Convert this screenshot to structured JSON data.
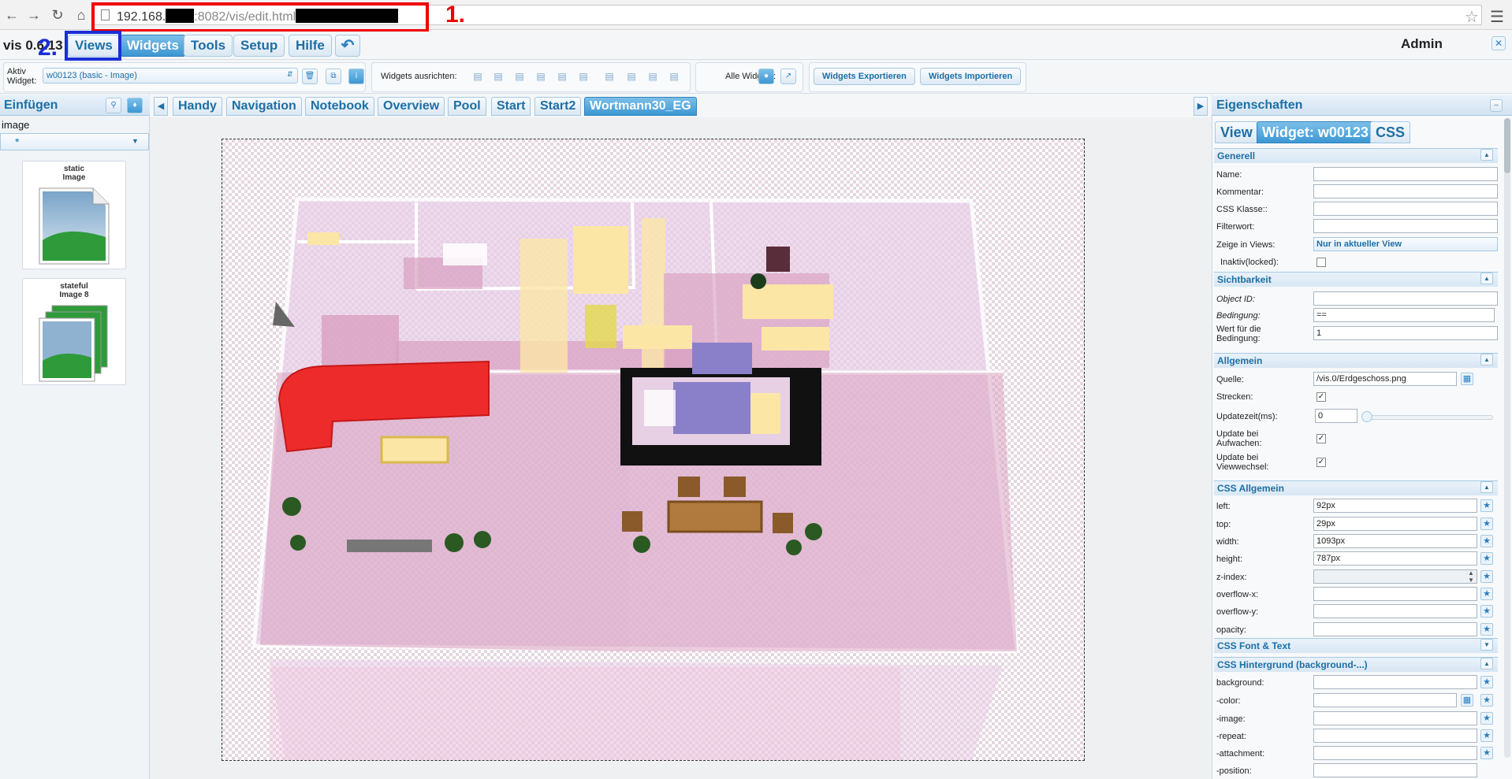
{
  "browser": {
    "url_prefix": "192.168.",
    "url_suffix": ":8082/vis/edit.html",
    "annotation1": "1."
  },
  "app": {
    "version": "vis 0.6.13",
    "annotation2": "2.",
    "menu": [
      "Views",
      "Widgets",
      "Tools",
      "Setup",
      "Hilfe"
    ],
    "active_menu": "Widgets",
    "user": "Admin"
  },
  "toolbar": {
    "aktiv_label_1": "Aktiv",
    "aktiv_label_2": "Widget:",
    "aktiv_widget": "w00123 (basic - Image)",
    "align_label": "Widgets ausrichten:",
    "alle_label": "Alle Widgets:",
    "export_label": "Widgets Exportieren",
    "import_label": "Widgets Importieren"
  },
  "left": {
    "title": "Einfügen",
    "filter_text": "image",
    "filter_select": "*",
    "widgets": [
      {
        "line1": "static",
        "line2": "Image"
      },
      {
        "line1": "stateful",
        "line2": "Image 8"
      }
    ]
  },
  "views": {
    "tabs": [
      "Handy",
      "Navigation",
      "Notebook",
      "Overview",
      "Pool",
      "Start",
      "Start2",
      "Wortmann30_EG"
    ],
    "active": "Wortmann30_EG"
  },
  "right": {
    "title": "Eigenschaften",
    "tabs": [
      "View",
      "Widget: w00123",
      "CSS"
    ],
    "active_tab": "Widget: w00123",
    "sections": {
      "generell": "Generell",
      "sichtbarkeit": "Sichtbarkeit",
      "allgemein": "Allgemein",
      "css_allgemein": "CSS Allgemein",
      "css_font": "CSS Font & Text",
      "css_bg": "CSS Hintergrund (background-...)"
    },
    "fields": {
      "name": "Name:",
      "kommentar": "Kommentar:",
      "css_klasse": "CSS Klasse::",
      "filterwort": "Filterwort:",
      "zeige_in_views": "Zeige in Views:",
      "zeige_value": "Nur in aktueller View",
      "inaktiv": "Inaktiv(locked):",
      "object_id": "Object ID:",
      "bedingung": "Bedingung:",
      "bedingung_value": "==",
      "wert_1": "Wert für die",
      "wert_2": "Bedingung:",
      "wert_value": "1",
      "quelle": "Quelle:",
      "quelle_value": "/vis.0/Erdgeschoss.png",
      "strecken": "Strecken:",
      "updatezeit": "Updatezeit(ms):",
      "updatezeit_value": "0",
      "update_aufwachen_1": "Update bei",
      "update_aufwachen_2": "Aufwachen:",
      "update_viewwechsel_1": "Update bei",
      "update_viewwechsel_2": "Viewwechsel:",
      "left": "left:",
      "left_value": "92px",
      "top": "top:",
      "top_value": "29px",
      "width": "width:",
      "width_value": "1093px",
      "height": "height:",
      "height_value": "787px",
      "zindex": "z-index:",
      "overflow_x": "overflow-x:",
      "overflow_y": "overflow-y:",
      "opacity": "opacity:",
      "background": "background:",
      "color": "-color:",
      "image": "-image:",
      "repeat": "-repeat:",
      "attachment": "-attachment:",
      "position": "-position:"
    }
  },
  "colors": {
    "accent": "#3c97d3",
    "link": "#1d6fa5",
    "annotation_red": "#ee0000",
    "annotation_blue": "#1a2fd6"
  }
}
